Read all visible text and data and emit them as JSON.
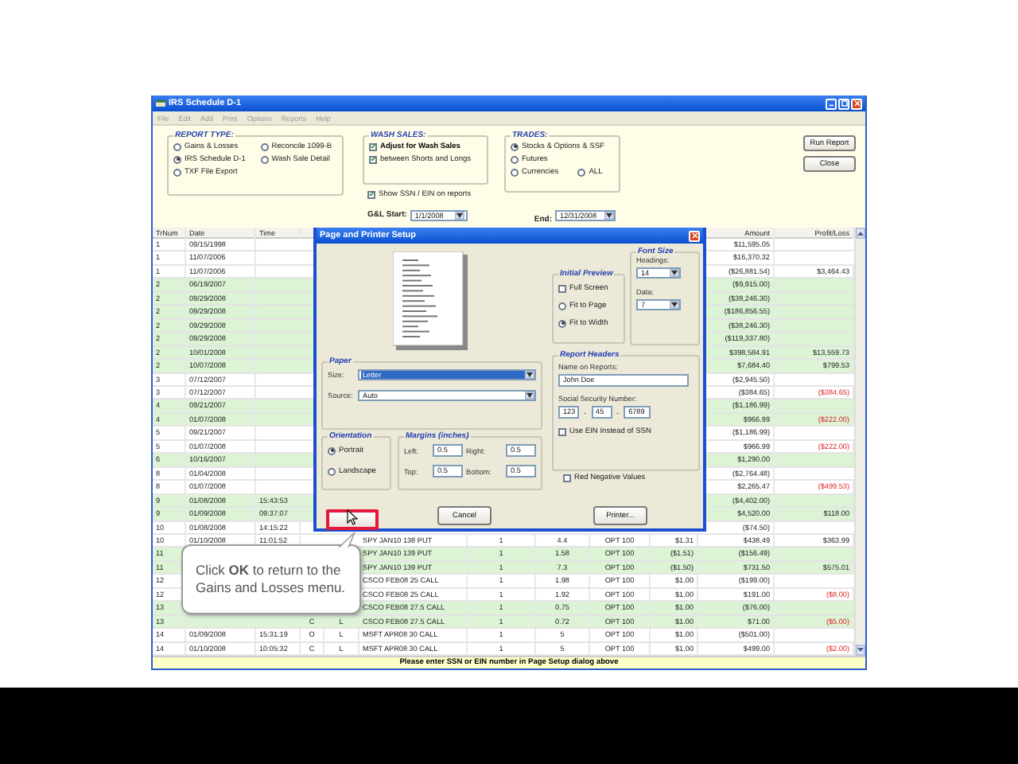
{
  "window": {
    "title": "IRS Schedule D-1"
  },
  "menu": [
    "File",
    "Edit",
    "Add",
    "Print",
    "Options",
    "Reports",
    "Help"
  ],
  "report_type": {
    "title": "REPORT TYPE:",
    "options": [
      {
        "label": "Gains & Losses",
        "selected": false
      },
      {
        "label": "IRS Schedule D-1",
        "selected": true
      },
      {
        "label": "TXF File Export",
        "selected": false
      },
      {
        "label": "Reconcile 1099-B",
        "selected": false
      },
      {
        "label": "Wash Sale Detail",
        "selected": false
      }
    ]
  },
  "wash_sales": {
    "title": "WASH SALES:",
    "options": [
      {
        "label": "Adjust for Wash Sales",
        "checked": true
      },
      {
        "label": "between Shorts and Longs",
        "checked": true
      }
    ]
  },
  "trades": {
    "title": "TRADES:",
    "options": [
      {
        "label": "Stocks & Options & SSF",
        "selected": true
      },
      {
        "label": "Futures",
        "selected": false
      },
      {
        "label": "Currencies",
        "selected": false
      },
      {
        "label": "ALL",
        "selected": false
      }
    ]
  },
  "show_ssn": {
    "label": "Show SSN / EIN on reports",
    "checked": true
  },
  "gl_start": {
    "label": "G&L Start:",
    "value": "1/1/2008"
  },
  "end": {
    "label": "End:",
    "value": "12/31/2008"
  },
  "buttons": [
    "Run Report",
    "Close"
  ],
  "table": {
    "columns": {
      "trnum": "TrNum",
      "date": "Date",
      "time": "Time",
      "amount": "Amount",
      "profit_loss": "Profit/Loss"
    },
    "rows": [
      {
        "trnum": "1",
        "date": "09/15/1998",
        "amount": "$11,595.05",
        "shaded": false
      },
      {
        "trnum": "1",
        "date": "11/07/2006",
        "amount": "$16,370.32",
        "shaded": false
      },
      {
        "trnum": "1",
        "date": "11/07/2006",
        "amount": "($26,881.54)",
        "profit_loss": "$3,464.43",
        "shaded": false,
        "loss": false
      },
      {
        "trnum": "2",
        "date": "06/19/2007",
        "amount": "($9,915.00)",
        "shaded": true
      },
      {
        "trnum": "2",
        "date": "09/29/2008",
        "amount": "($38,246.30)",
        "shaded": true
      },
      {
        "trnum": "2",
        "date": "09/29/2008",
        "amount": "($186,856.55)",
        "shaded": true
      },
      {
        "trnum": "2",
        "date": "09/29/2008",
        "amount": "($38,246.30)",
        "shaded": true
      },
      {
        "trnum": "2",
        "date": "09/29/2008",
        "amount": "($119,337.80)",
        "shaded": true
      },
      {
        "trnum": "2",
        "date": "10/01/2008",
        "amount": "$398,584.91",
        "profit_loss": "$13,559.73",
        "shaded": true,
        "loss": false
      },
      {
        "trnum": "2",
        "date": "10/07/2008",
        "amount": "$7,684.40",
        "profit_loss": "$799.53",
        "shaded": true,
        "loss": false
      },
      {
        "trnum": "3",
        "date": "07/12/2007",
        "amount": "($2,945.50)",
        "shaded": false
      },
      {
        "trnum": "3",
        "date": "07/12/2007",
        "amount": "($384.65)",
        "profit_loss": "($384.65)",
        "shaded": false,
        "loss": true
      },
      {
        "trnum": "4",
        "date": "09/21/2007",
        "amount": "($1,186.99)",
        "shaded": true
      },
      {
        "trnum": "4",
        "date": "01/07/2008",
        "amount": "$966.99",
        "profit_loss": "($222.00)",
        "shaded": true,
        "loss": true
      },
      {
        "trnum": "5",
        "date": "09/21/2007",
        "amount": "($1,186.99)",
        "shaded": false
      },
      {
        "trnum": "5",
        "date": "01/07/2008",
        "amount": "$966.99",
        "profit_loss": "($222.00)",
        "shaded": false,
        "loss": true
      },
      {
        "trnum": "6",
        "date": "10/16/2007",
        "amount": "$1,290.00",
        "shaded": true
      },
      {
        "trnum": "8",
        "date": "01/04/2008",
        "amount": "($2,764.48)",
        "shaded": false
      },
      {
        "trnum": "8",
        "date": "01/07/2008",
        "amount": "$2,265.47",
        "profit_loss": "($499.53)",
        "shaded": false,
        "loss": true
      },
      {
        "trnum": "9",
        "date": "01/08/2008",
        "time": "15:43:53",
        "amount": "($4,402.00)",
        "shaded": true
      },
      {
        "trnum": "9",
        "date": "01/09/2008",
        "time": "09:37:07",
        "amount": "$4,520.00",
        "profit_loss": "$118.00",
        "shaded": true,
        "loss": false
      },
      {
        "trnum": "10",
        "date": "01/08/2008",
        "time": "14:15:22",
        "amount": "($74.50)",
        "shaded": false
      },
      {
        "trnum": "10",
        "date": "01/10/2008",
        "time": "11:01:52",
        "description": "SPY JAN10 138 PUT",
        "qty": "1",
        "price": "4.4",
        "type": "OPT 100",
        "commission": "$1.31",
        "amount": "$438.49",
        "profit_loss": "$363.99",
        "shaded": false,
        "loss": false
      },
      {
        "trnum": "11",
        "description": "SPY JAN10 139 PUT",
        "qty": "1",
        "price": "1.58",
        "type": "OPT 100",
        "commission": "($1.51)",
        "amount": "($156.49)",
        "shaded": true
      },
      {
        "trnum": "11",
        "description": "SPY JAN10 139 PUT",
        "qty": "1",
        "price": "7.3",
        "type": "OPT 100",
        "commission": "($1.50)",
        "amount": "$731.50",
        "profit_loss": "$575.01",
        "shaded": true,
        "loss": false
      },
      {
        "trnum": "12",
        "description": "CSCO FEB08 25 CALL",
        "qty": "1",
        "price": "1.98",
        "type": "OPT 100",
        "commission": "$1.00",
        "amount": "($199.00)",
        "shaded": false
      },
      {
        "trnum": "12",
        "description": "CSCO FEB08 25 CALL",
        "qty": "1",
        "price": "1.92",
        "type": "OPT 100",
        "commission": "$1.00",
        "amount": "$191.00",
        "profit_loss": "($8.00)",
        "shaded": false,
        "loss": true
      },
      {
        "trnum": "13",
        "description": "CSCO FEB08 27.5 CALL",
        "qty": "1",
        "price": "0.75",
        "type": "OPT 100",
        "commission": "$1.00",
        "amount": "($76.00)",
        "shaded": true
      },
      {
        "trnum": "13",
        "co": "C",
        "ls": "L",
        "description": "CSCO FEB08 27.5 CALL",
        "qty": "1",
        "price": "0.72",
        "type": "OPT 100",
        "commission": "$1.00",
        "amount": "$71.00",
        "profit_loss": "($5.00)",
        "shaded": true,
        "loss": true
      },
      {
        "trnum": "14",
        "date": "01/09/2008",
        "time": "15:31:19",
        "co": "O",
        "ls": "L",
        "description": "MSFT APR08 30 CALL",
        "qty": "1",
        "price": "5",
        "type": "OPT 100",
        "commission": "$1.00",
        "amount": "($501.00)",
        "shaded": false
      },
      {
        "trnum": "14",
        "date": "01/10/2008",
        "time": "10:05:32",
        "co": "C",
        "ls": "L",
        "description": "MSFT APR08 30 CALL",
        "qty": "1",
        "price": "5",
        "type": "OPT 100",
        "commission": "$1.00",
        "amount": "$499.00",
        "profit_loss": "($2.00)",
        "shaded": false,
        "loss": true
      }
    ]
  },
  "status_bar": "Please enter SSN or EIN number in Page Setup dialog above",
  "dialog": {
    "title": "Page and Printer Setup",
    "paper": {
      "title": "Paper",
      "size": {
        "label": "Size:",
        "value": "Letter"
      },
      "source": {
        "label": "Source:",
        "value": "Auto"
      }
    },
    "orientation": {
      "title": "Orientation",
      "options": [
        {
          "label": "Portrait",
          "selected": true
        },
        {
          "label": "Landscape",
          "selected": false
        }
      ]
    },
    "margins": {
      "title": "Margins (inches)",
      "fields": [
        {
          "label": "Left:",
          "value": "0.5"
        },
        {
          "label": "Right:",
          "value": "0.5"
        },
        {
          "label": "Top:",
          "value": "0.5"
        },
        {
          "label": "Bottom:",
          "value": "0.5"
        }
      ]
    },
    "initial_preview": {
      "title": "Initial Preview",
      "full_screen": {
        "label": "Full Screen",
        "checked": false
      },
      "options": [
        {
          "label": "Fit to Page",
          "selected": false
        },
        {
          "label": "Fit to Width",
          "selected": true
        }
      ]
    },
    "font_size": {
      "title": "Font Size",
      "headings": {
        "label": "Headings:",
        "value": "14"
      },
      "data": {
        "label": "Data:",
        "value": "7"
      }
    },
    "report_headers": {
      "title": "Report Headers",
      "name": {
        "label": "Name on Reports:",
        "value": "John Doe"
      },
      "ssn": {
        "label": "Social Security Number:",
        "items": [
          {
            "kind": "field",
            "text": "123"
          },
          {
            "kind": "dash",
            "text": "-"
          },
          {
            "kind": "field",
            "text": "45"
          },
          {
            "kind": "dash",
            "text": "-"
          },
          {
            "kind": "field",
            "text": "6789"
          }
        ]
      },
      "use_ein": {
        "label": "Use EIN Instead of SSN",
        "checked": false
      }
    },
    "red_negative": {
      "label": "Red Negative Values",
      "checked": false
    },
    "ok_button": {
      "highlighted": true
    },
    "buttons": [
      "Cancel",
      "Printer..."
    ]
  },
  "tooltip": "Click **OK** to return to the Gains and Losses menu."
}
